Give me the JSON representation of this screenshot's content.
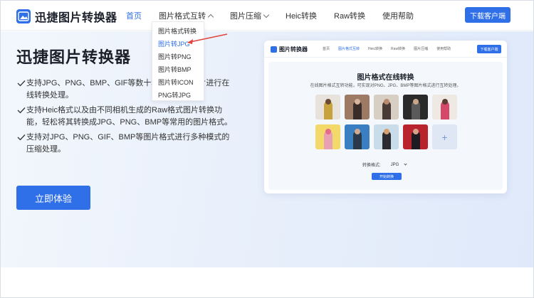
{
  "header": {
    "logo_text": "迅捷图片转换器",
    "nav": [
      {
        "label": "首页"
      },
      {
        "label": "图片格式互转"
      },
      {
        "label": "图片压缩"
      },
      {
        "label": "Heic转换"
      },
      {
        "label": "Raw转换"
      },
      {
        "label": "使用帮助"
      }
    ],
    "download_label": "下载客户端"
  },
  "dropdown": {
    "items": [
      "图片格式转换",
      "图片转JPG",
      "图片转PNG",
      "图片转BMP",
      "图片转ICON",
      "PNG转JPG"
    ]
  },
  "hero": {
    "title": "迅捷图片转换器",
    "features": [
      "支持JPG、PNG、BMP、GIF等数十种常见格式图片进行在线转换处理。",
      "支持Heic格式以及由不同相机生成的Raw格式图片转换功能，轻松将其转换成JPG、PNG、BMP等常用的图片格式。",
      "支持对JPG、PNG、GIF、BMP等图片格式进行多种模式的压缩处理。"
    ],
    "cta_label": "立即体验"
  },
  "mockup": {
    "logo_text": "图片转换器",
    "nav": [
      "首页",
      "图片格式互转",
      "Heic转换",
      "Raw转换",
      "图片压缩",
      "使用帮助"
    ],
    "download_label": "下载客户端",
    "title": "图片格式在线转换",
    "subtitle": "在线图片格式互转功能，可实现对PNG、JPG、BMP等图片格式进行互转处理。",
    "format_label": "转换格式:",
    "format_value": "JPG",
    "start_label": "开始转换",
    "add_symbol": "+"
  },
  "colors": {
    "accent": "#2f6fe8",
    "dropdown_arrow": "#e0463c"
  }
}
